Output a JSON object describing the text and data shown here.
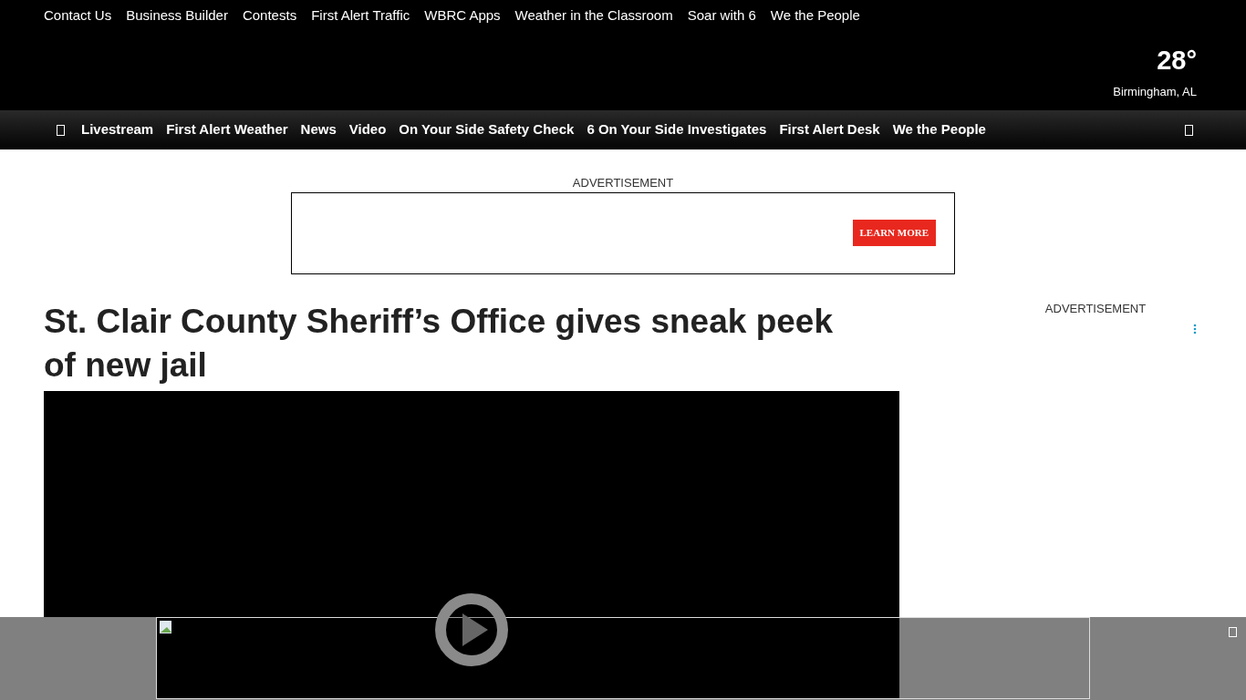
{
  "top_links": [
    "Contact Us",
    "Business Builder",
    "Contests",
    "First Alert Traffic",
    "WBRC Apps",
    "Weather in the Classroom",
    "Soar with 6",
    "We the People"
  ],
  "weather": {
    "temperature": "28°",
    "location": "Birmingham, AL"
  },
  "nav": [
    "Livestream",
    "First Alert Weather",
    "News",
    "Video",
    "On Your Side Safety Check",
    "6 On Your Side Investigates",
    "First Alert Desk",
    "We the People"
  ],
  "top_ad": {
    "label": "ADVERTISEMENT",
    "button": "LEARN MORE"
  },
  "headline": "St. Clair County Sheriff’s Office gives sneak peek of new jail",
  "side_ad": {
    "label": "ADVERTISEMENT"
  }
}
